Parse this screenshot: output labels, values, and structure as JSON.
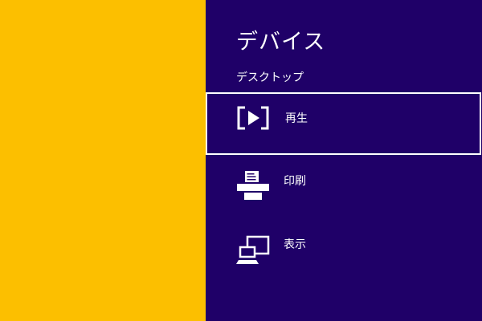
{
  "theme": {
    "desktop_color": "#fcbf00",
    "pane_color": "#1f0068",
    "text_color": "#ffffff",
    "selection_border_color": "#ffffff"
  },
  "pane": {
    "title": "デバイス",
    "subtitle": "デスクトップ",
    "items": [
      {
        "label": "再生",
        "icon": "play-to-icon",
        "selected": true
      },
      {
        "label": "印刷",
        "icon": "printer-icon",
        "selected": false
      },
      {
        "label": "表示",
        "icon": "project-screen-icon",
        "selected": false
      }
    ]
  }
}
